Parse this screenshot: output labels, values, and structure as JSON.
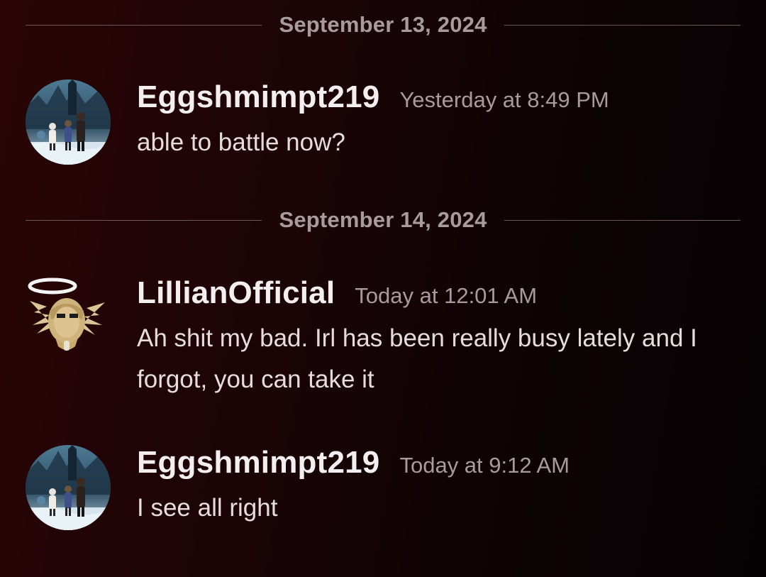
{
  "dividers": [
    {
      "date": "September 13, 2024"
    },
    {
      "date": "September 14, 2024"
    }
  ],
  "messages": [
    {
      "username": "Eggshmimpt219",
      "timestamp": "Yesterday at 8:49 PM",
      "text": "able to battle now?",
      "avatar": "trainer-group-avatar"
    },
    {
      "username": "LillianOfficial",
      "timestamp": "Today at 12:01 AM",
      "text": "Ah shit my bad. Irl has been really busy lately and I forgot, you can take it",
      "avatar": "shedinja-avatar"
    },
    {
      "username": "Eggshmimpt219",
      "timestamp": "Today at 9:12 AM",
      "text": "I see all right",
      "avatar": "trainer-group-avatar"
    }
  ],
  "colors": {
    "background_start": "#2a0505",
    "background_end": "#060203",
    "username": "#f3eff0",
    "timestamp": "#a79b9e",
    "message_text": "#e4dcdd",
    "divider_line": "#6b5557"
  }
}
